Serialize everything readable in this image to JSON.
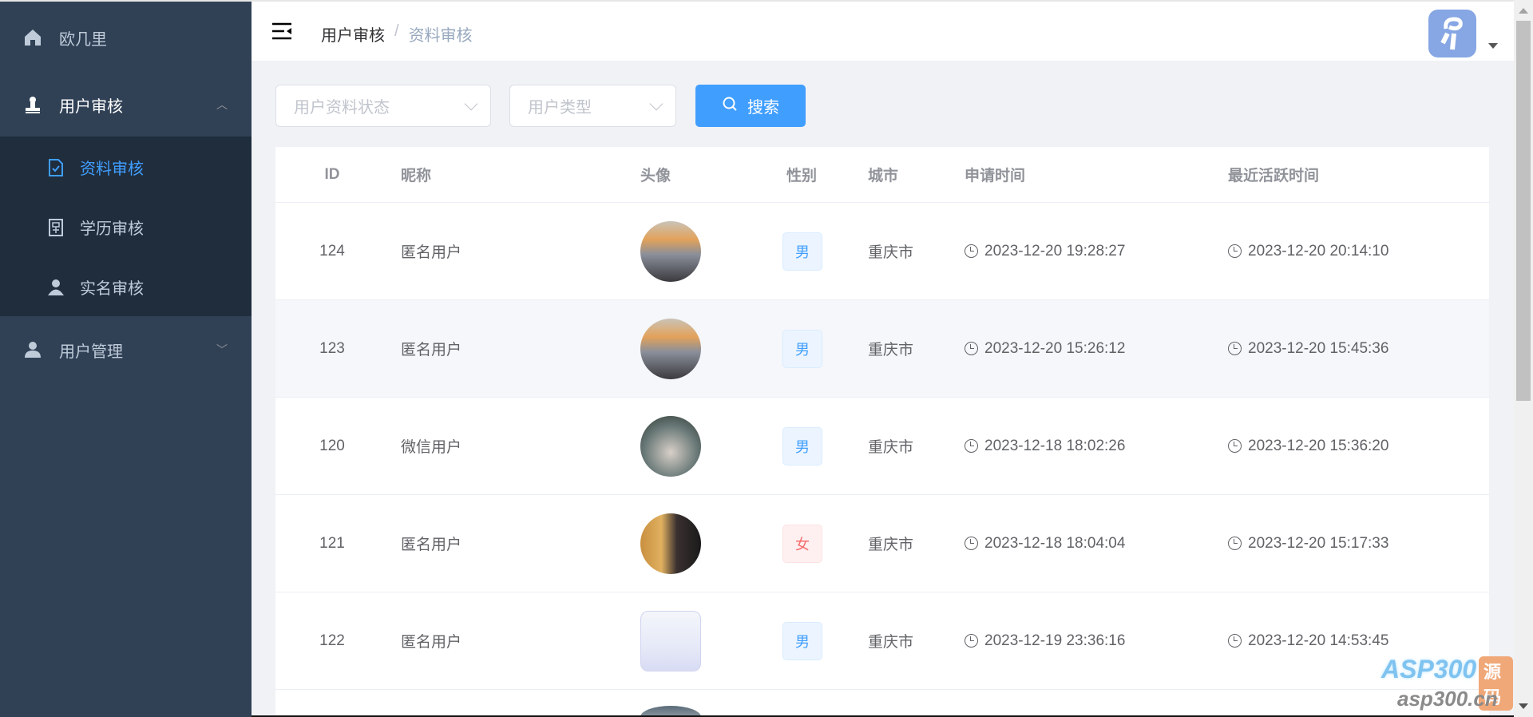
{
  "sidebar": {
    "home": "欧几里",
    "user_review": "用户审核",
    "sub_items": [
      "资料审核",
      "学历审核",
      "实名审核"
    ],
    "user_manage": "用户管理"
  },
  "header": {
    "breadcrumb": [
      "用户审核",
      "资料审核"
    ],
    "separator": "/"
  },
  "filters": {
    "status_placeholder": "用户资料状态",
    "type_placeholder": "用户类型",
    "search_label": "搜索"
  },
  "table": {
    "columns": [
      "ID",
      "昵称",
      "头像",
      "性别",
      "城市",
      "申请时间",
      "最近活跃时间"
    ],
    "rows": [
      {
        "id": "124",
        "nickname": "匿名用户",
        "gender": "男",
        "city": "重庆市",
        "apply_time": "2023-12-20 19:28:27",
        "active_time": "2023-12-20 20:14:10"
      },
      {
        "id": "123",
        "nickname": "匿名用户",
        "gender": "男",
        "city": "重庆市",
        "apply_time": "2023-12-20 15:26:12",
        "active_time": "2023-12-20 15:45:36"
      },
      {
        "id": "120",
        "nickname": "微信用户",
        "gender": "男",
        "city": "重庆市",
        "apply_time": "2023-12-18 18:02:26",
        "active_time": "2023-12-20 15:36:20"
      },
      {
        "id": "121",
        "nickname": "匿名用户",
        "gender": "女",
        "city": "重庆市",
        "apply_time": "2023-12-18 18:04:04",
        "active_time": "2023-12-20 15:17:33"
      },
      {
        "id": "122",
        "nickname": "匿名用户",
        "gender": "男",
        "city": "重庆市",
        "apply_time": "2023-12-19 23:36:16",
        "active_time": "2023-12-20 14:53:45"
      }
    ]
  },
  "watermark": {
    "brand": "ASP300",
    "tag": "源码",
    "url": "asp300.cn"
  },
  "colors": {
    "sidebar": "#304156",
    "submenu": "#1f2d3d",
    "accent": "#409eff",
    "female": "#f56c6c"
  }
}
